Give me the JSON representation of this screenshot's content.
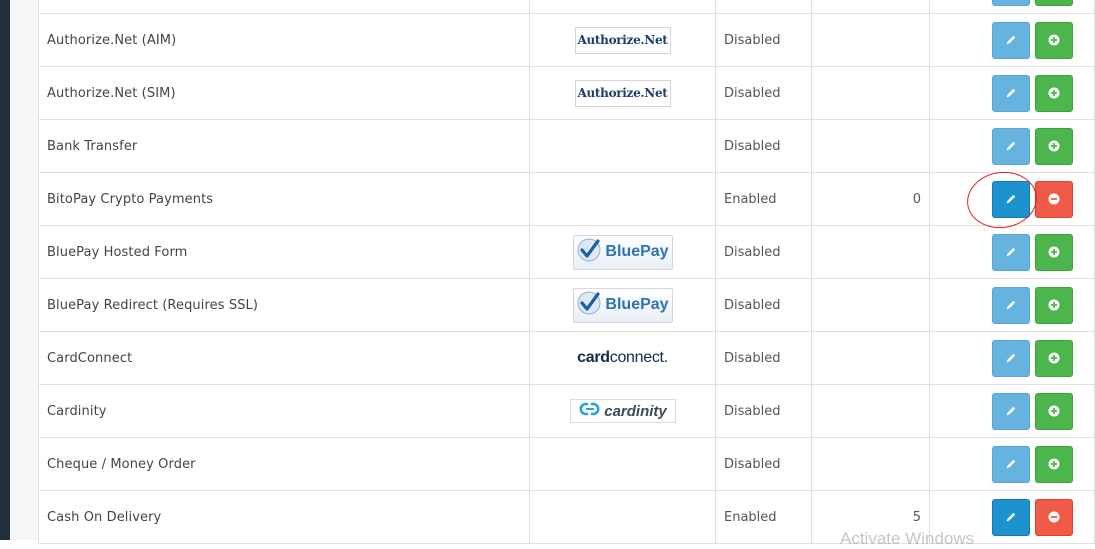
{
  "rows": [
    {
      "name": "",
      "logo": "",
      "status": "",
      "sort": "",
      "installed": false
    },
    {
      "name": "Authorize.Net (AIM)",
      "logo": "authorize-net",
      "logo_text": "Authorize.Net",
      "status": "Disabled",
      "sort": "",
      "installed": false
    },
    {
      "name": "Authorize.Net (SIM)",
      "logo": "authorize-net",
      "logo_text": "Authorize.Net",
      "status": "Disabled",
      "sort": "",
      "installed": false
    },
    {
      "name": "Bank Transfer",
      "logo": "",
      "status": "Disabled",
      "sort": "",
      "installed": false
    },
    {
      "name": "BitoPay Crypto Payments",
      "logo": "",
      "status": "Enabled",
      "sort": "0",
      "installed": true,
      "highlighted": true
    },
    {
      "name": "BluePay Hosted Form",
      "logo": "bluepay",
      "logo_text": "BluePay",
      "status": "Disabled",
      "sort": "",
      "installed": false
    },
    {
      "name": "BluePay Redirect (Requires SSL)",
      "logo": "bluepay",
      "logo_text": "BluePay",
      "status": "Disabled",
      "sort": "",
      "installed": false
    },
    {
      "name": "CardConnect",
      "logo": "cardconnect",
      "logo_text_bold": "card",
      "logo_text_rest": "connect.",
      "status": "Disabled",
      "sort": "",
      "installed": false
    },
    {
      "name": "Cardinity",
      "logo": "cardinity",
      "logo_text": "cardinity",
      "status": "Disabled",
      "sort": "",
      "installed": false
    },
    {
      "name": "Cheque / Money Order",
      "logo": "",
      "status": "Disabled",
      "sort": "",
      "installed": false
    },
    {
      "name": "Cash On Delivery",
      "logo": "",
      "status": "Enabled",
      "sort": "5",
      "installed": true
    }
  ],
  "icons": {
    "edit": "pencil-icon",
    "install": "plus-circle-icon",
    "uninstall": "minus-circle-icon"
  },
  "colors": {
    "edit": "#66b3e0",
    "edit_active": "#1e91cf",
    "install": "#4cb64c",
    "uninstall": "#f05a48",
    "annotation": "#e02020"
  },
  "watermark": "Activate Windows"
}
